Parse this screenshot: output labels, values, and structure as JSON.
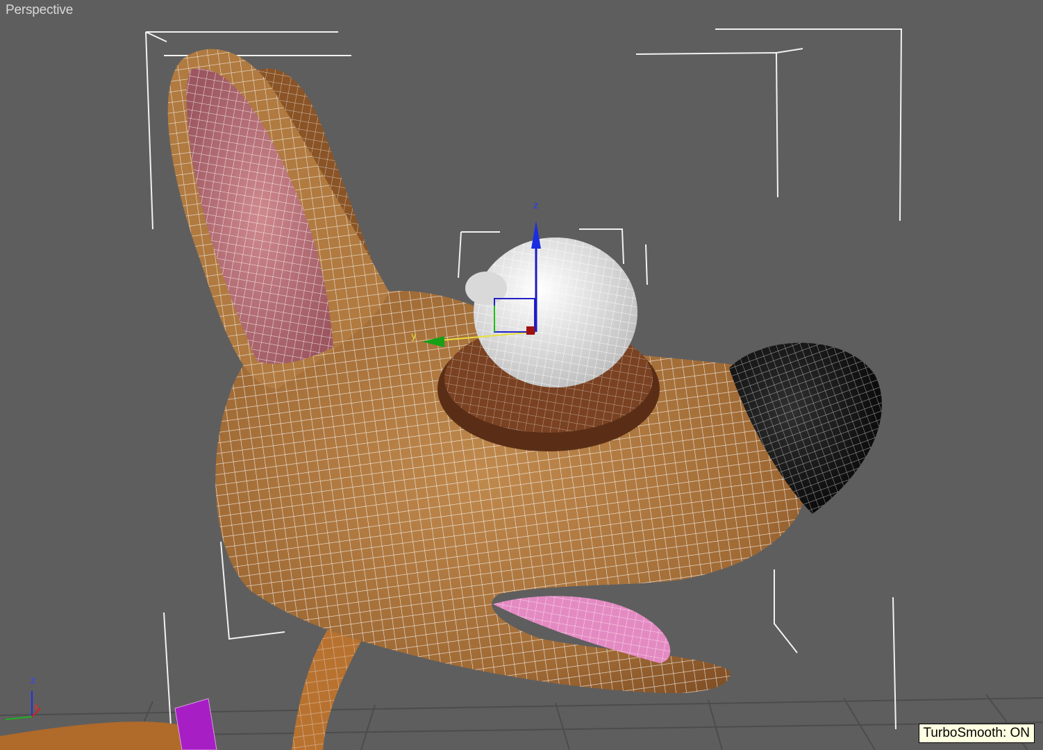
{
  "viewport": {
    "label": "Perspective",
    "background": "#5e5e5e"
  },
  "status": {
    "turbosmooth": "TurboSmooth: ON"
  },
  "gizmo": {
    "z_label": "z",
    "y_label": "y"
  },
  "world_axis": {
    "z_label": "z",
    "x_label": "x"
  },
  "colors": {
    "skin": "#b07a40",
    "skin_dark": "#7a4a22",
    "ear_inner": "#c97a80",
    "nose": "#151515",
    "eye": "#e8e8e8",
    "tongue": "#e28ac0",
    "collar": "#a020c0",
    "wire": "#ffffff",
    "grid": "#4a4a4a",
    "tooltip_bg": "#ffffe1"
  }
}
